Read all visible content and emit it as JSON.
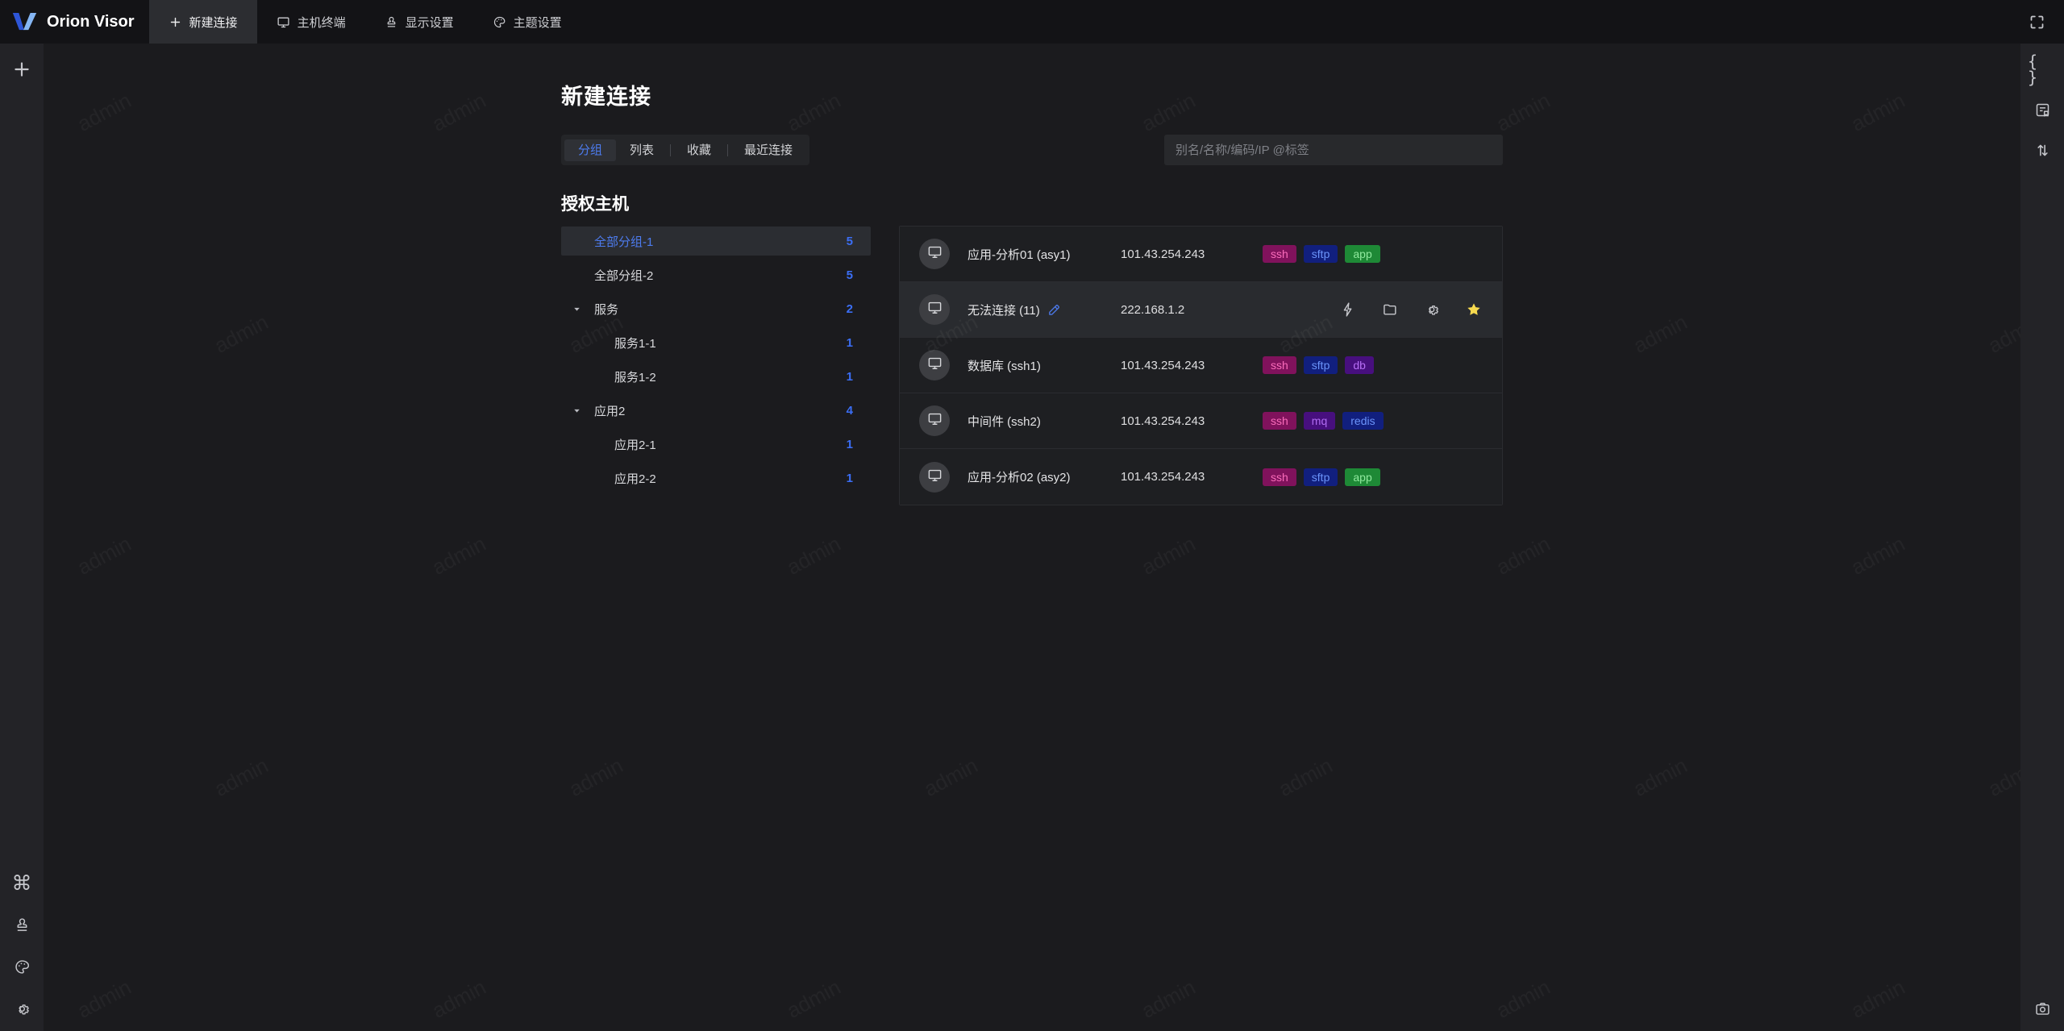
{
  "app": {
    "name": "Orion Visor"
  },
  "colors": {
    "accent": "#4d7cf0",
    "count": "#3b6ef5",
    "star": "#f7da4f"
  },
  "topbar": {
    "tabs": [
      {
        "key": "new-connection",
        "label": "新建连接",
        "icon": "plus",
        "active": true
      },
      {
        "key": "host-terminal",
        "label": "主机终端",
        "icon": "monitor",
        "active": false
      },
      {
        "key": "display-settings",
        "label": "显示设置",
        "icon": "stamp",
        "active": false
      },
      {
        "key": "theme-settings",
        "label": "主题设置",
        "icon": "palette",
        "active": false
      }
    ],
    "fullscreen_icon": "fullscreen"
  },
  "left_sidebar": {
    "top": [
      {
        "key": "new",
        "icon": "plus"
      }
    ],
    "bottom": [
      {
        "key": "shortcuts",
        "icon": "command"
      },
      {
        "key": "display",
        "icon": "stamp"
      },
      {
        "key": "theme",
        "icon": "palette"
      },
      {
        "key": "settings",
        "icon": "gear"
      }
    ]
  },
  "right_sidebar": {
    "top": [
      {
        "key": "json",
        "icon": "braces"
      },
      {
        "key": "bookmark",
        "icon": "doc-bookmark"
      },
      {
        "key": "sort",
        "icon": "sort"
      }
    ],
    "bottom": [
      {
        "key": "screenshot",
        "icon": "camera"
      }
    ]
  },
  "page": {
    "title": "新建连接",
    "view_tabs": [
      {
        "key": "group",
        "label": "分组",
        "active": true,
        "divider_before": false
      },
      {
        "key": "list",
        "label": "列表",
        "active": false,
        "divider_before": false
      },
      {
        "key": "favorite",
        "label": "收藏",
        "active": false,
        "divider_before": true
      },
      {
        "key": "recent",
        "label": "最近连接",
        "active": false,
        "divider_before": true
      }
    ],
    "search": {
      "placeholder": "别名/名称/编码/IP @标签"
    }
  },
  "tree": {
    "heading": "授权主机",
    "items": [
      {
        "label": "全部分组-1",
        "count": "5",
        "level": 0,
        "selected": true,
        "expanded": false
      },
      {
        "label": "全部分组-2",
        "count": "5",
        "level": 0,
        "selected": false,
        "expanded": false
      },
      {
        "label": "服务",
        "count": "2",
        "level": 0,
        "selected": false,
        "expanded": true
      },
      {
        "label": "服务1-1",
        "count": "1",
        "level": 1,
        "selected": false,
        "expanded": false
      },
      {
        "label": "服务1-2",
        "count": "1",
        "level": 1,
        "selected": false,
        "expanded": false
      },
      {
        "label": "应用2",
        "count": "4",
        "level": 0,
        "selected": false,
        "expanded": true
      },
      {
        "label": "应用2-1",
        "count": "1",
        "level": 1,
        "selected": false,
        "expanded": false
      },
      {
        "label": "应用2-2",
        "count": "1",
        "level": 1,
        "selected": false,
        "expanded": false
      }
    ]
  },
  "hosts": [
    {
      "name": "应用-分析01 (asy1)",
      "ip": "101.43.254.243",
      "editable": false,
      "hover": false,
      "tags": [
        "ssh",
        "sftp",
        "app"
      ],
      "actions": []
    },
    {
      "name": "无法连接 (11)",
      "ip": "222.168.1.2",
      "editable": true,
      "hover": true,
      "tags": [],
      "actions": [
        {
          "key": "connect",
          "icon": "lightning"
        },
        {
          "key": "files",
          "icon": "folder"
        },
        {
          "key": "settings",
          "icon": "gear"
        },
        {
          "key": "favorite",
          "icon": "star",
          "active": true
        }
      ]
    },
    {
      "name": "数据库 (ssh1)",
      "ip": "101.43.254.243",
      "editable": false,
      "hover": false,
      "tags": [
        "ssh",
        "sftp",
        "db"
      ],
      "actions": []
    },
    {
      "name": "中间件 (ssh2)",
      "ip": "101.43.254.243",
      "editable": false,
      "hover": false,
      "tags": [
        "ssh",
        "mq",
        "redis"
      ],
      "actions": []
    },
    {
      "name": "应用-分析02 (asy2)",
      "ip": "101.43.254.243",
      "editable": false,
      "hover": false,
      "tags": [
        "ssh",
        "sftp",
        "app"
      ],
      "actions": []
    }
  ],
  "tag_styles": {
    "ssh": {
      "bg": "#80125c",
      "fg": "#fb6cbb"
    },
    "sftp": {
      "bg": "#111f7e",
      "fg": "#6a93fa"
    },
    "app": {
      "bg": "#1e8936",
      "fg": "#90e99e"
    },
    "db": {
      "bg": "#470f7e",
      "fg": "#b76ef5"
    },
    "mq": {
      "bg": "#470f7e",
      "fg": "#b06cf2"
    },
    "redis": {
      "bg": "#111f7e",
      "fg": "#6a93fa"
    }
  },
  "watermark": {
    "text": "admin"
  }
}
